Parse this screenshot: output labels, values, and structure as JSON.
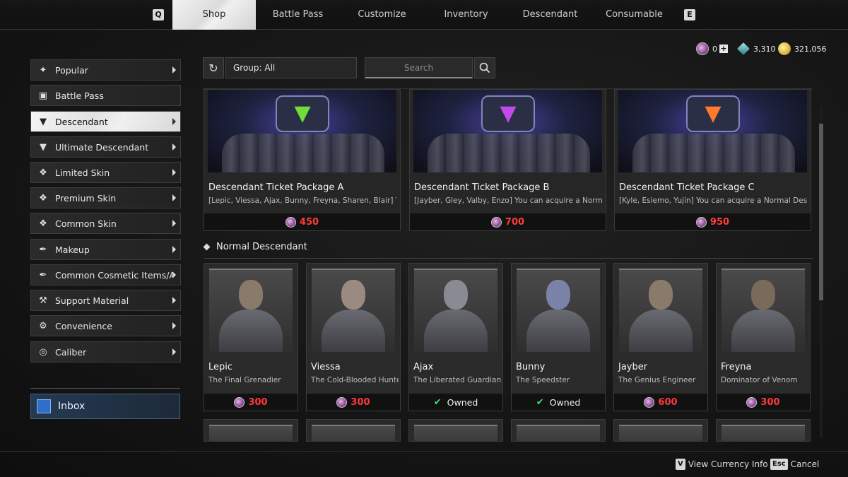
{
  "nav": {
    "key_left": "Q",
    "key_right": "E",
    "tabs": [
      {
        "label": "Shop",
        "active": true
      },
      {
        "label": "Battle Pass",
        "active": false
      },
      {
        "label": "Customize",
        "active": false
      },
      {
        "label": "Inventory",
        "active": false
      },
      {
        "label": "Descendant",
        "active": false
      },
      {
        "label": "Consumable",
        "active": false
      }
    ]
  },
  "currency": {
    "caliber": "0",
    "crystal": "3,310",
    "gold": "321,056"
  },
  "sidebar": {
    "items": [
      {
        "label": "Popular",
        "icon": "star-icon"
      },
      {
        "label": "Battle Pass",
        "icon": "battle-pass-icon"
      },
      {
        "label": "Descendant",
        "icon": "descendant-icon",
        "active": true
      },
      {
        "label": "Ultimate Descendant",
        "icon": "ultimate-icon"
      },
      {
        "label": "Limited Skin",
        "icon": "shirt-icon"
      },
      {
        "label": "Premium Skin",
        "icon": "premium-shirt-icon"
      },
      {
        "label": "Common Skin",
        "icon": "common-shirt-icon"
      },
      {
        "label": "Makeup",
        "icon": "makeup-icon"
      },
      {
        "label": "Common Cosmetic Items/Atta",
        "icon": "cosmetic-icon"
      },
      {
        "label": "Support Material",
        "icon": "support-icon"
      },
      {
        "label": "Convenience",
        "icon": "convenience-icon"
      },
      {
        "label": "Caliber",
        "icon": "caliber-icon"
      }
    ],
    "inbox_label": "Inbox"
  },
  "filter": {
    "group_label": "Group: All",
    "search_placeholder": "Search"
  },
  "packages": [
    {
      "title": "Descendant Ticket Package A",
      "desc": "[Lepic, Viessa, Ajax, Bunny, Freyna, Sharen, Blair] You can acquire a Normal Descendant",
      "price": "450",
      "emblem_color": "#6fdc3a"
    },
    {
      "title": "Descendant Ticket Package B",
      "desc": "[Jayber, Gley, Valby, Enzo] You can acquire a Normal Descendant",
      "price": "700",
      "emblem_color": "#c24ae8"
    },
    {
      "title": "Descendant Ticket Package C",
      "desc": "[Kyle, Esiemo, Yujin] You can acquire a Normal Descendant",
      "price": "950",
      "emblem_color": "#ff7a2a"
    }
  ],
  "section_title": "Normal Descendant",
  "descendants": [
    {
      "name": "Lepic",
      "subtitle": "The Final Grenadier",
      "price": "300",
      "owned": false,
      "tone": "#8a7a6a"
    },
    {
      "name": "Viessa",
      "subtitle": "The Cold-Blooded Hunter",
      "price": "300",
      "owned": false,
      "tone": "#9a8a80"
    },
    {
      "name": "Ajax",
      "subtitle": "The Liberated Guardian",
      "price": "",
      "owned": true,
      "tone": "#8a8a92"
    },
    {
      "name": "Bunny",
      "subtitle": "The Speedster",
      "price": "",
      "owned": true,
      "tone": "#7a82a8"
    },
    {
      "name": "Jayber",
      "subtitle": "The Genius Engineer",
      "price": "600",
      "owned": false,
      "tone": "#8a7a6a"
    },
    {
      "name": "Freyna",
      "subtitle": "Dominator of Venom",
      "price": "300",
      "owned": false,
      "tone": "#7a6a5a"
    }
  ],
  "owned_label": "Owned",
  "footer": {
    "view_key": "V",
    "view_label": "View Currency Info",
    "cancel_key": "Esc",
    "cancel_label": "Cancel"
  }
}
